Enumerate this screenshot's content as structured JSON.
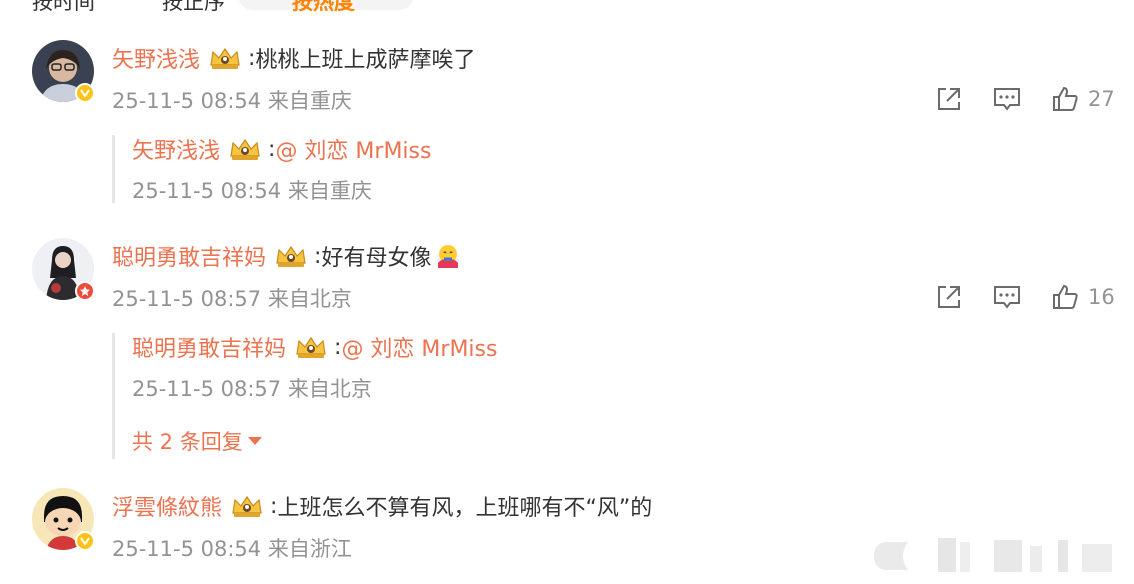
{
  "sort_tabs": [
    "按时间",
    "按正序",
    "按热度"
  ],
  "comments": [
    {
      "username": "矢野浅浅",
      "text": "桃桃上班上成萨摩唉了",
      "time": "25-11-5 08:54",
      "location": "来自重庆",
      "likes": "27",
      "badge": "verified-gold",
      "reply": {
        "username": "矢野浅浅",
        "mention": "@ 刘恋 MrMiss",
        "time": "25-11-5 08:54",
        "location": "来自重庆"
      }
    },
    {
      "username": "聪明勇敢吉祥妈",
      "text": "好有母女像",
      "emoji": "hug-emoji",
      "time": "25-11-5 08:57",
      "location": "来自北京",
      "likes": "16",
      "badge": "verified-red",
      "reply": {
        "username": "聪明勇敢吉祥妈",
        "mention": "@ 刘恋 MrMiss",
        "time": "25-11-5 08:57",
        "location": "来自北京"
      },
      "more_replies": "共 2 条回复"
    },
    {
      "username": "浮雲條紋熊",
      "text": "上班怎么不算有风，上班哪有不“风”的",
      "time": "25-11-5 08:54",
      "location": "来自浙江",
      "badge": "verified-gold"
    }
  ],
  "colors": {
    "username": "#eb7350",
    "meta": "#939393",
    "text": "#333333",
    "badge_gold": "#ffc21a",
    "badge_red": "#f04a3a",
    "active_tab": "#ff8200"
  },
  "icons": [
    "share-icon",
    "comment-icon",
    "like-icon",
    "crown-icon",
    "verified-icon"
  ]
}
